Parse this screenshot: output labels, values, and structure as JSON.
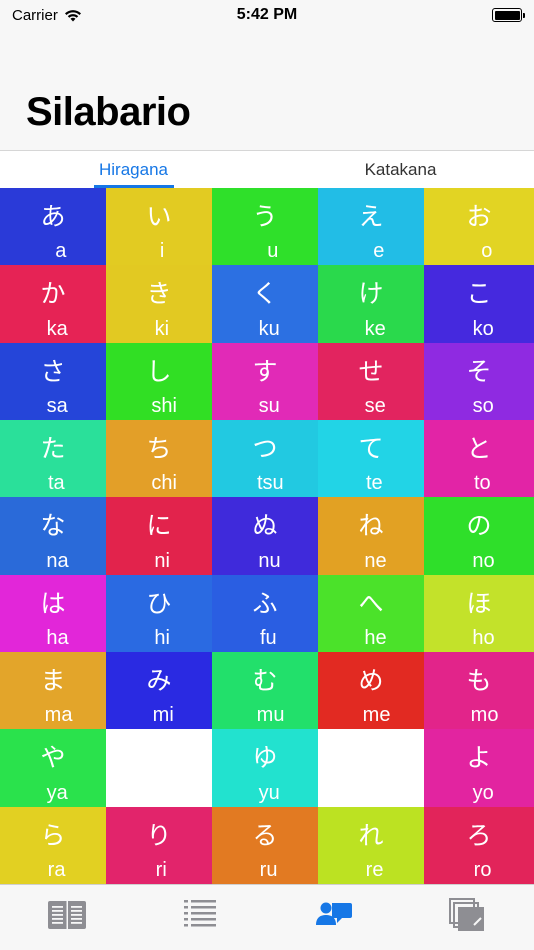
{
  "status": {
    "carrier": "Carrier",
    "time": "5:42 PM"
  },
  "nav": {
    "title": "Silabario"
  },
  "segments": [
    {
      "label": "Hiragana",
      "active": true
    },
    {
      "label": "Katakana",
      "active": false
    }
  ],
  "grid": [
    [
      {
        "kana": "あ",
        "romaji": "a",
        "color": "#2a3ad8"
      },
      {
        "kana": "い",
        "romaji": "i",
        "color": "#e2cb22"
      },
      {
        "kana": "う",
        "romaji": "u",
        "color": "#2fe02a"
      },
      {
        "kana": "え",
        "romaji": "e",
        "color": "#22bde6"
      },
      {
        "kana": "お",
        "romaji": "o",
        "color": "#e2d423"
      }
    ],
    [
      {
        "kana": "か",
        "romaji": "ka",
        "color": "#e62355"
      },
      {
        "kana": "き",
        "romaji": "ki",
        "color": "#e2c922"
      },
      {
        "kana": "く",
        "romaji": "ku",
        "color": "#2c70e2"
      },
      {
        "kana": "け",
        "romaji": "ke",
        "color": "#2ad94c"
      },
      {
        "kana": "こ",
        "romaji": "ko",
        "color": "#4529de"
      }
    ],
    [
      {
        "kana": "さ",
        "romaji": "sa",
        "color": "#2545d9"
      },
      {
        "kana": "し",
        "romaji": "shi",
        "color": "#31df24"
      },
      {
        "kana": "す",
        "romaji": "su",
        "color": "#e12ab7"
      },
      {
        "kana": "せ",
        "romaji": "se",
        "color": "#e2245f"
      },
      {
        "kana": "そ",
        "romaji": "so",
        "color": "#8f2ae1"
      }
    ],
    [
      {
        "kana": "た",
        "romaji": "ta",
        "color": "#2ae09a"
      },
      {
        "kana": "ち",
        "romaji": "chi",
        "color": "#e39f28"
      },
      {
        "kana": "つ",
        "romaji": "tsu",
        "color": "#22c9e1"
      },
      {
        "kana": "て",
        "romaji": "te",
        "color": "#22d4e6"
      },
      {
        "kana": "と",
        "romaji": "to",
        "color": "#e224a6"
      }
    ],
    [
      {
        "kana": "な",
        "romaji": "na",
        "color": "#2a6ad9"
      },
      {
        "kana": "に",
        "romaji": "ni",
        "color": "#e2234c"
      },
      {
        "kana": "ぬ",
        "romaji": "nu",
        "color": "#3f2adb"
      },
      {
        "kana": "ね",
        "romaji": "ne",
        "color": "#e2a123"
      },
      {
        "kana": "の",
        "romaji": "no",
        "color": "#2fdf2a"
      }
    ],
    [
      {
        "kana": "は",
        "romaji": "ha",
        "color": "#e226d9"
      },
      {
        "kana": "ひ",
        "romaji": "hi",
        "color": "#2a6ae2"
      },
      {
        "kana": "ふ",
        "romaji": "fu",
        "color": "#2a5ee2"
      },
      {
        "kana": "へ",
        "romaji": "he",
        "color": "#4be22a"
      },
      {
        "kana": "ほ",
        "romaji": "ho",
        "color": "#c3e22a"
      }
    ],
    [
      {
        "kana": "ま",
        "romaji": "ma",
        "color": "#e3a52a"
      },
      {
        "kana": "み",
        "romaji": "mi",
        "color": "#2a2ae2"
      },
      {
        "kana": "む",
        "romaji": "mu",
        "color": "#22e06b"
      },
      {
        "kana": "め",
        "romaji": "me",
        "color": "#e22a22"
      },
      {
        "kana": "も",
        "romaji": "mo",
        "color": "#e2248a"
      }
    ],
    [
      {
        "kana": "や",
        "romaji": "ya",
        "color": "#2ae24c"
      },
      null,
      {
        "kana": "ゆ",
        "romaji": "yu",
        "color": "#22e2cf"
      },
      null,
      {
        "kana": "よ",
        "romaji": "yo",
        "color": "#e224a0"
      }
    ],
    [
      {
        "kana": "ら",
        "romaji": "ra",
        "color": "#e2d022"
      },
      {
        "kana": "り",
        "romaji": "ri",
        "color": "#e2246b"
      },
      {
        "kana": "る",
        "romaji": "ru",
        "color": "#e27a22"
      },
      {
        "kana": "れ",
        "romaji": "re",
        "color": "#bce222"
      },
      {
        "kana": "ろ",
        "romaji": "ro",
        "color": "#e2245a"
      }
    ]
  ],
  "tabbar": [
    {
      "icon": "book-icon",
      "active": false
    },
    {
      "icon": "list-icon",
      "active": false
    },
    {
      "icon": "people-chat-icon",
      "active": true
    },
    {
      "icon": "cards-icon",
      "active": false
    }
  ],
  "colors": {
    "accent": "#1677e6",
    "inactive_icon": "#8e8e93"
  }
}
